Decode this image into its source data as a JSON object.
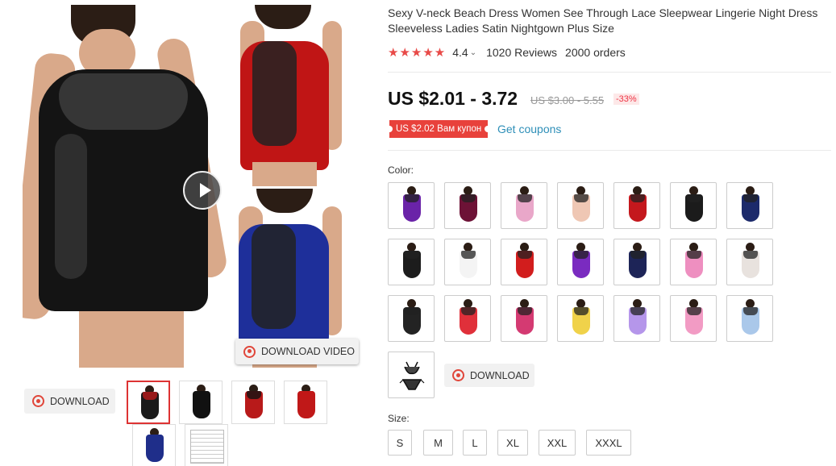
{
  "product": {
    "title": "Sexy V-neck Beach Dress Women See Through Lace Sleepwear Lingerie Night Dress Sleeveless Ladies Satin Nightgown Plus Size",
    "stars": "★★★★★",
    "rating": "4.4",
    "reviews": "1020 Reviews",
    "orders": "2000 orders",
    "price": "US $2.01 - 3.72",
    "original_price": "US $3.00 - 5.55",
    "discount": "-33%",
    "coupon": "US $2.02 Вам купон",
    "get_coupons": "Get coupons"
  },
  "gallery": {
    "download_video_label": "DOWNLOAD VIDEO",
    "download_label": "DOWNLOAD",
    "thumbnails": [
      {
        "color": "#1a1a1a",
        "accent": "#b81a1a"
      },
      {
        "color": "#111111",
        "accent": "#111111"
      },
      {
        "color": "#b81a1a",
        "accent": "#111111"
      },
      {
        "color": "#c01818",
        "accent": "#c01818"
      },
      {
        "color": "#1f2e8a",
        "accent": "#1f2e8a"
      },
      {
        "color": "#f2f2f2",
        "accent": "#bbbbbb"
      }
    ]
  },
  "color": {
    "label": "Color:",
    "swatches": [
      {
        "name": "purple",
        "hex": "#6a23a8"
      },
      {
        "name": "wine",
        "hex": "#6d1236"
      },
      {
        "name": "pink",
        "hex": "#e9a7c9"
      },
      {
        "name": "champagne",
        "hex": "#efc7b4"
      },
      {
        "name": "red",
        "hex": "#c4181d"
      },
      {
        "name": "black",
        "hex": "#1b1b1b"
      },
      {
        "name": "navy",
        "hex": "#1c2a6b"
      },
      {
        "name": "black-2",
        "hex": "#1c1c1c"
      },
      {
        "name": "white",
        "hex": "#f4f4f4"
      },
      {
        "name": "red-2",
        "hex": "#d21d1d"
      },
      {
        "name": "purple-2",
        "hex": "#7a2bc0"
      },
      {
        "name": "navy-2",
        "hex": "#1d2457"
      },
      {
        "name": "pink-2",
        "hex": "#ee8fc0"
      },
      {
        "name": "white-2",
        "hex": "#e8e2de"
      },
      {
        "name": "black-3",
        "hex": "#232323"
      },
      {
        "name": "red-3",
        "hex": "#e0303a"
      },
      {
        "name": "rose",
        "hex": "#d43a72"
      },
      {
        "name": "yellow",
        "hex": "#f0d24a"
      },
      {
        "name": "lavender",
        "hex": "#b596ea"
      },
      {
        "name": "pink-3",
        "hex": "#f29bc4"
      },
      {
        "name": "light-blue",
        "hex": "#aac8ea"
      }
    ],
    "download_label": "DOWNLOAD"
  },
  "size": {
    "label": "Size:",
    "options": [
      "S",
      "M",
      "L",
      "XL",
      "XXL",
      "XXXL"
    ]
  }
}
